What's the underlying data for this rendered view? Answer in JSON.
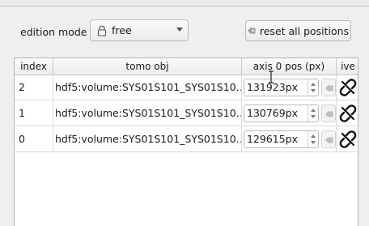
{
  "toolbar": {
    "mode_label": "edition mode",
    "mode_value": "free",
    "reset_label": "reset all positions"
  },
  "table": {
    "columns": [
      "index",
      "tomo obj",
      "axis 0 pos (px)",
      "ive"
    ],
    "rows": [
      {
        "index": "2",
        "obj": "hdf5:volume:SYS01S101_SYS01S10…",
        "pos": "131923px"
      },
      {
        "index": "1",
        "obj": "hdf5:volume:SYS01S101_SYS01S10…",
        "pos": "130769px"
      },
      {
        "index": "0",
        "obj": "hdf5:volume:SYS01S101_SYS01S10…",
        "pos": "129615px"
      }
    ]
  },
  "icons": {
    "mode": "lock-icon",
    "reset": "eraser-icon",
    "row_action": "broken-link-icon"
  }
}
